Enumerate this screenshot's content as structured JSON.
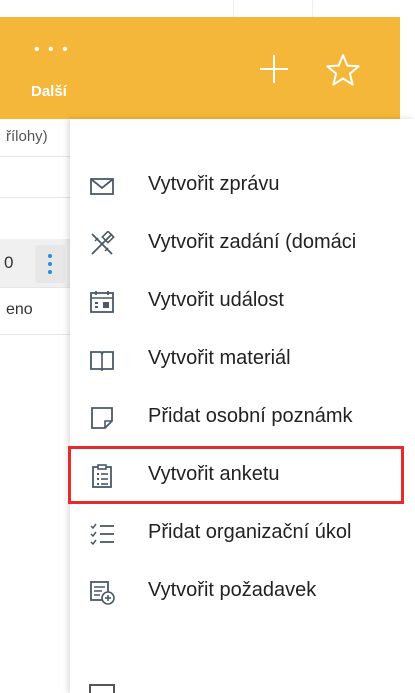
{
  "toolbar": {
    "more_label": "Další",
    "more_icon": "three-dots-icon",
    "add_icon": "plus-icon",
    "favorite_icon": "star-icon",
    "background_color": "#f5b739"
  },
  "background_page": {
    "column_fragment": "řílohy)",
    "row_number": "0",
    "status_fragment": "eno"
  },
  "menu": {
    "highlighted_index": 6,
    "highlight_color": "#e52b2b",
    "items": [
      {
        "label": "Vytvořit zprávu",
        "icon": "envelope-icon"
      },
      {
        "label": "Vytvořit zadání (domáci",
        "icon": "pencil-ruler-icon"
      },
      {
        "label": "Vytvořit událost",
        "icon": "calendar-icon"
      },
      {
        "label": "Vytvořit materiál",
        "icon": "book-icon"
      },
      {
        "label": "Přidat osobní poznámk",
        "icon": "note-icon"
      },
      {
        "label": "Vytvořit anketu",
        "icon": "clipboard-list-icon"
      },
      {
        "label": "Přidat organizační úkol",
        "icon": "checklist-icon"
      },
      {
        "label": "Vytvořit požadavek",
        "icon": "request-add-icon"
      }
    ]
  }
}
